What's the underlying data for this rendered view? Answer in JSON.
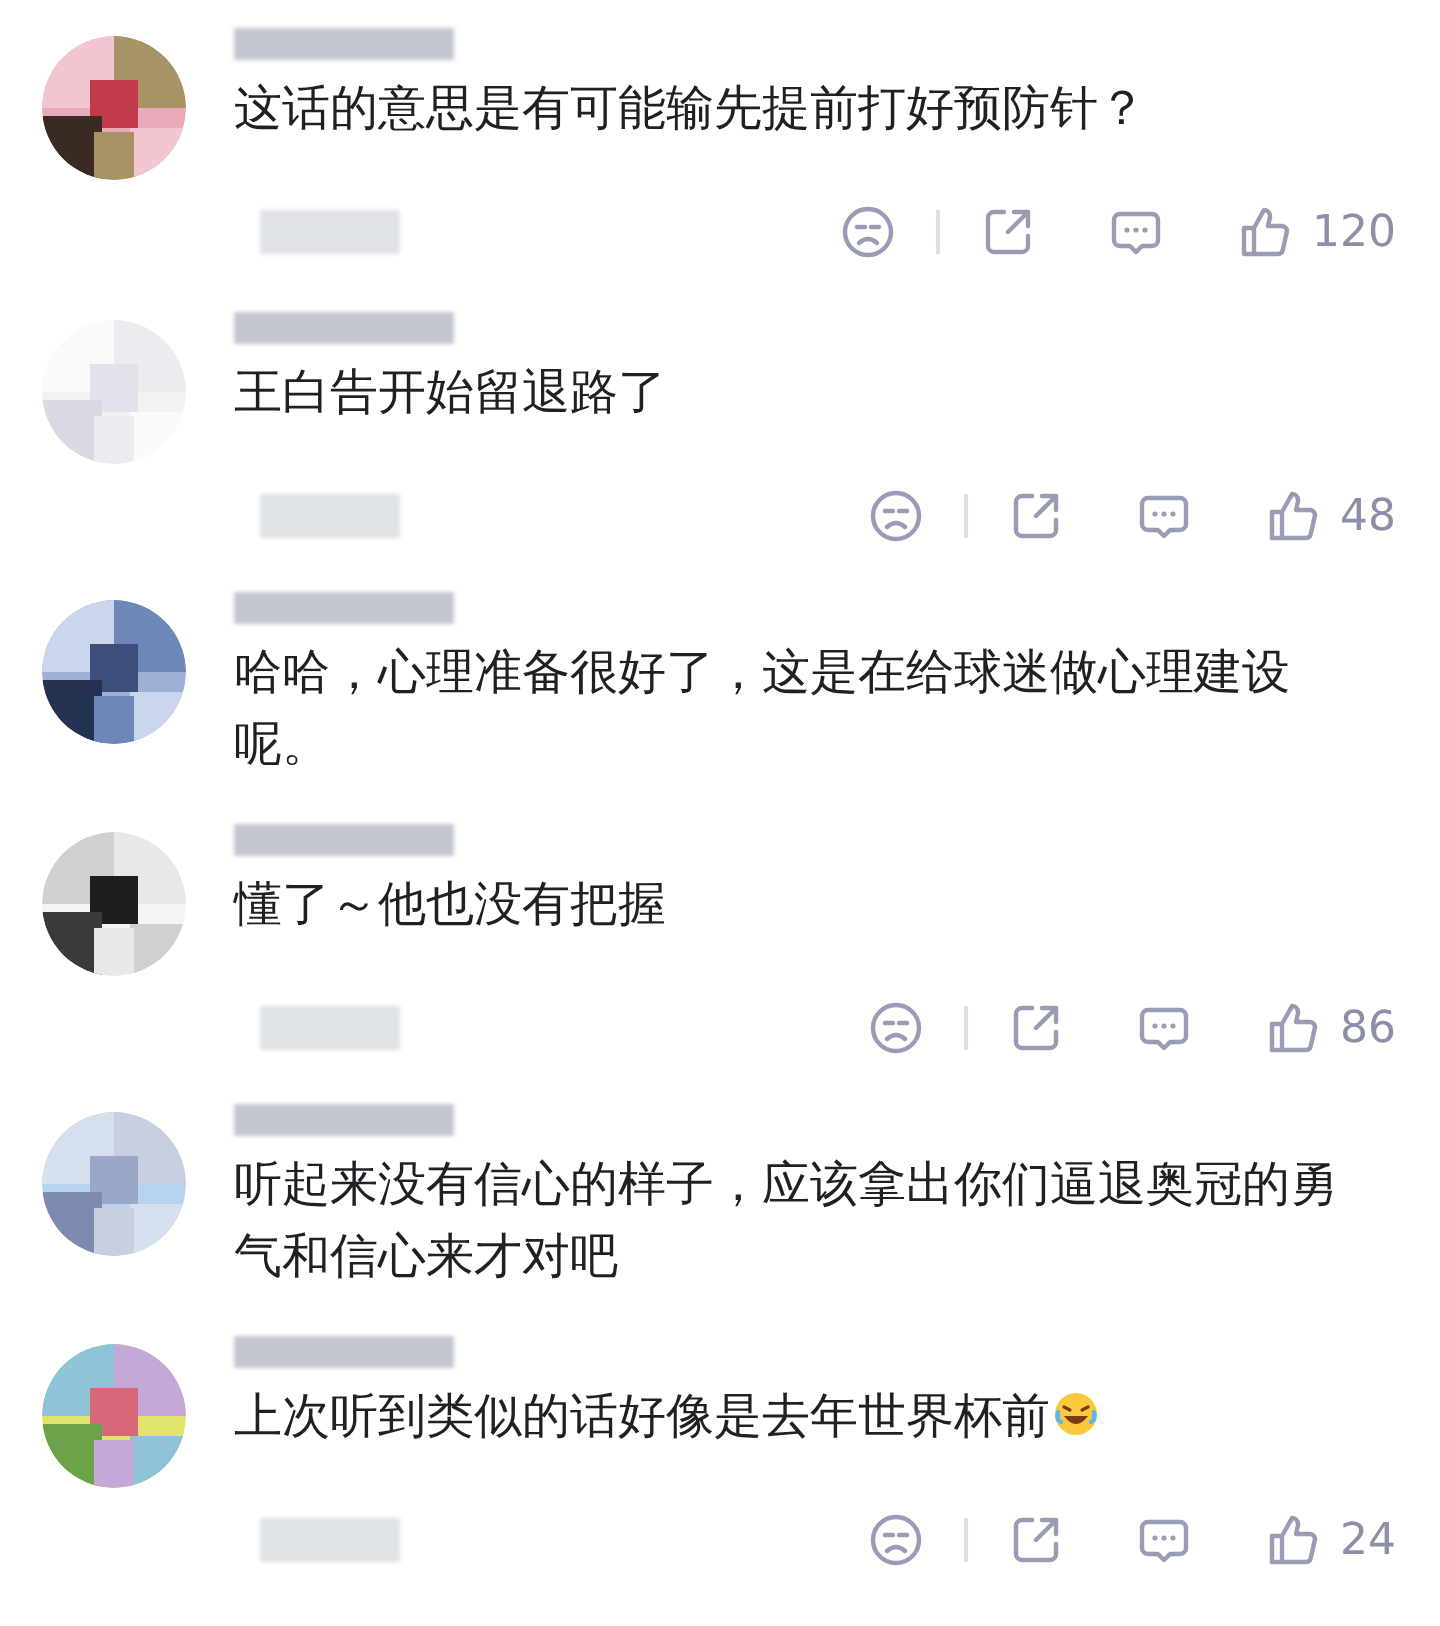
{
  "comments": [
    {
      "text": "这话的意思是有可能输先提前打好预防针？",
      "trailing_emoji": false,
      "like_count": "120"
    },
    {
      "text": "王白告开始留退路了",
      "trailing_emoji": false,
      "like_count": "48"
    },
    {
      "text": "哈哈，心理准备很好了，这是在给球迷做心理建设呢。",
      "trailing_emoji": false
    },
    {
      "text": "懂了～他也没有把握",
      "trailing_emoji": false,
      "like_count": "86"
    },
    {
      "text": "听起来没有信心的样子，应该拿出你们逼退奥冠的勇气和信心来才对吧",
      "trailing_emoji": false
    },
    {
      "text": "上次听到类似的话好像是去年世界杯前",
      "trailing_emoji": true,
      "like_count": "24"
    }
  ]
}
